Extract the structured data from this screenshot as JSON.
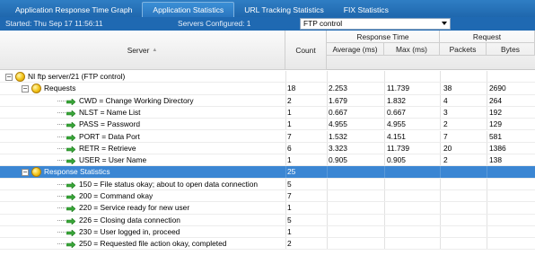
{
  "tabs": [
    {
      "label": "Application Response Time Graph",
      "active": false
    },
    {
      "label": "Application Statistics",
      "active": true
    },
    {
      "label": "URL Tracking Statistics",
      "active": false
    },
    {
      "label": "FIX Statistics",
      "active": false
    }
  ],
  "info": {
    "started": "Started: Thu Sep 17 11:56:11",
    "servers": "Servers Configured: 1",
    "filter_value": "FTP control"
  },
  "columns": {
    "server": "Server",
    "count": "Count",
    "response_time": "Response Time",
    "avg": "Average (ms)",
    "max": "Max (ms)",
    "request": "Request",
    "packets": "Packets",
    "bytes": "Bytes"
  },
  "rows": [
    {
      "level": 0,
      "type": "server",
      "name": "NI ftp server/21 (FTP control)",
      "count": "",
      "avg": "",
      "max": "",
      "packets": "",
      "bytes": "",
      "selected": false
    },
    {
      "level": 1,
      "type": "group",
      "name": "Requests",
      "count": "18",
      "avg": "2.253",
      "max": "11.739",
      "packets": "38",
      "bytes": "2690",
      "selected": false
    },
    {
      "level": 2,
      "type": "item",
      "name": "CWD = Change Working Directory",
      "count": "2",
      "avg": "1.679",
      "max": "1.832",
      "packets": "4",
      "bytes": "264",
      "selected": false
    },
    {
      "level": 2,
      "type": "item",
      "name": "NLST = Name List",
      "count": "1",
      "avg": "0.667",
      "max": "0.667",
      "packets": "3",
      "bytes": "192",
      "selected": false
    },
    {
      "level": 2,
      "type": "item",
      "name": "PASS = Password",
      "count": "1",
      "avg": "4.955",
      "max": "4.955",
      "packets": "2",
      "bytes": "129",
      "selected": false
    },
    {
      "level": 2,
      "type": "item",
      "name": "PORT = Data Port",
      "count": "7",
      "avg": "1.532",
      "max": "4.151",
      "packets": "7",
      "bytes": "581",
      "selected": false
    },
    {
      "level": 2,
      "type": "item",
      "name": "RETR = Retrieve",
      "count": "6",
      "avg": "3.323",
      "max": "11.739",
      "packets": "20",
      "bytes": "1386",
      "selected": false
    },
    {
      "level": 2,
      "type": "item",
      "name": "USER = User Name",
      "count": "1",
      "avg": "0.905",
      "max": "0.905",
      "packets": "2",
      "bytes": "138",
      "selected": false
    },
    {
      "level": 1,
      "type": "group",
      "name": "Response Statistics",
      "count": "25",
      "avg": "",
      "max": "",
      "packets": "",
      "bytes": "",
      "selected": true
    },
    {
      "level": 2,
      "type": "item",
      "name": "150 = File status okay; about to open data connection",
      "count": "5",
      "avg": "",
      "max": "",
      "packets": "",
      "bytes": "",
      "selected": false
    },
    {
      "level": 2,
      "type": "item",
      "name": "200 = Command okay",
      "count": "7",
      "avg": "",
      "max": "",
      "packets": "",
      "bytes": "",
      "selected": false
    },
    {
      "level": 2,
      "type": "item",
      "name": "220 = Service ready for new user",
      "count": "1",
      "avg": "",
      "max": "",
      "packets": "",
      "bytes": "",
      "selected": false
    },
    {
      "level": 2,
      "type": "item",
      "name": "226 = Closing data connection",
      "count": "5",
      "avg": "",
      "max": "",
      "packets": "",
      "bytes": "",
      "selected": false
    },
    {
      "level": 2,
      "type": "item",
      "name": "230 = User logged in, proceed",
      "count": "1",
      "avg": "",
      "max": "",
      "packets": "",
      "bytes": "",
      "selected": false
    },
    {
      "level": 2,
      "type": "item",
      "name": "250 = Requested file action okay, completed",
      "count": "2",
      "avg": "",
      "max": "",
      "packets": "",
      "bytes": "",
      "selected": false
    }
  ],
  "colors": {
    "tabbar": "#1f67ad",
    "selected_row": "#3b86d3",
    "header": "#ededed"
  },
  "icons": {
    "expander": "minus-box-icon",
    "status": "status-ball-icon",
    "item": "green-arrow-icon"
  }
}
